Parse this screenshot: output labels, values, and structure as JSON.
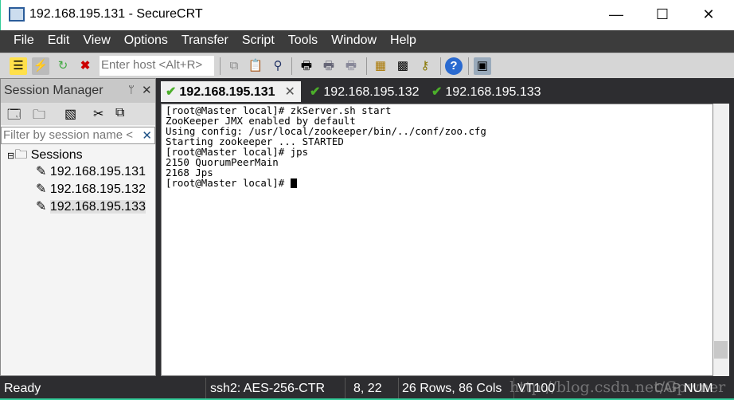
{
  "window": {
    "title": "192.168.195.131 - SecureCRT",
    "minimize": "—",
    "maximize": "☐",
    "close": "✕"
  },
  "menu": [
    "File",
    "Edit",
    "View",
    "Options",
    "Transfer",
    "Script",
    "Tools",
    "Window",
    "Help"
  ],
  "toolbar": {
    "host_placeholder": "Enter host <Alt+R>",
    "icons": [
      "connect-bar-icon",
      "quick-connect-icon",
      "reconnect-icon",
      "disconnect-icon",
      "copy-icon",
      "paste-icon",
      "find-icon",
      "print-icon",
      "print-selection-icon",
      "print-setup-icon",
      "session-options-icon",
      "global-options-icon",
      "keymap-icon",
      "help-icon",
      "sftp-icon"
    ]
  },
  "session_manager": {
    "title": "Session Manager",
    "pin": "ᛘ",
    "close": "✕",
    "filter_placeholder": "Filter by session name <",
    "filter_clear": "✕",
    "root": "Sessions",
    "sessions": [
      "192.168.195.131",
      "192.168.195.132",
      "192.168.195.133"
    ]
  },
  "tabs": [
    {
      "label": "192.168.195.131",
      "close": "✕"
    },
    {
      "label": "192.168.195.132"
    },
    {
      "label": "192.168.195.133"
    }
  ],
  "terminal": {
    "lines": [
      "[root@Master local]# zkServer.sh start",
      "ZooKeeper JMX enabled by default",
      "Using config: /usr/local/zookeeper/bin/../conf/zoo.cfg",
      "Starting zookeeper ... STARTED",
      "[root@Master local]# jps",
      "2150 QuorumPeerMain",
      "2168 Jps",
      "[root@Master local]# "
    ]
  },
  "status": {
    "ready": "Ready",
    "cipher": "ssh2: AES-256-CTR",
    "cursor": "8,  22",
    "size": "26 Rows, 86 Cols",
    "emulation": "VT100",
    "cap": "CAP",
    "num": "NUM",
    "watermark": "http://blog.csdn.net/Gpwner"
  }
}
